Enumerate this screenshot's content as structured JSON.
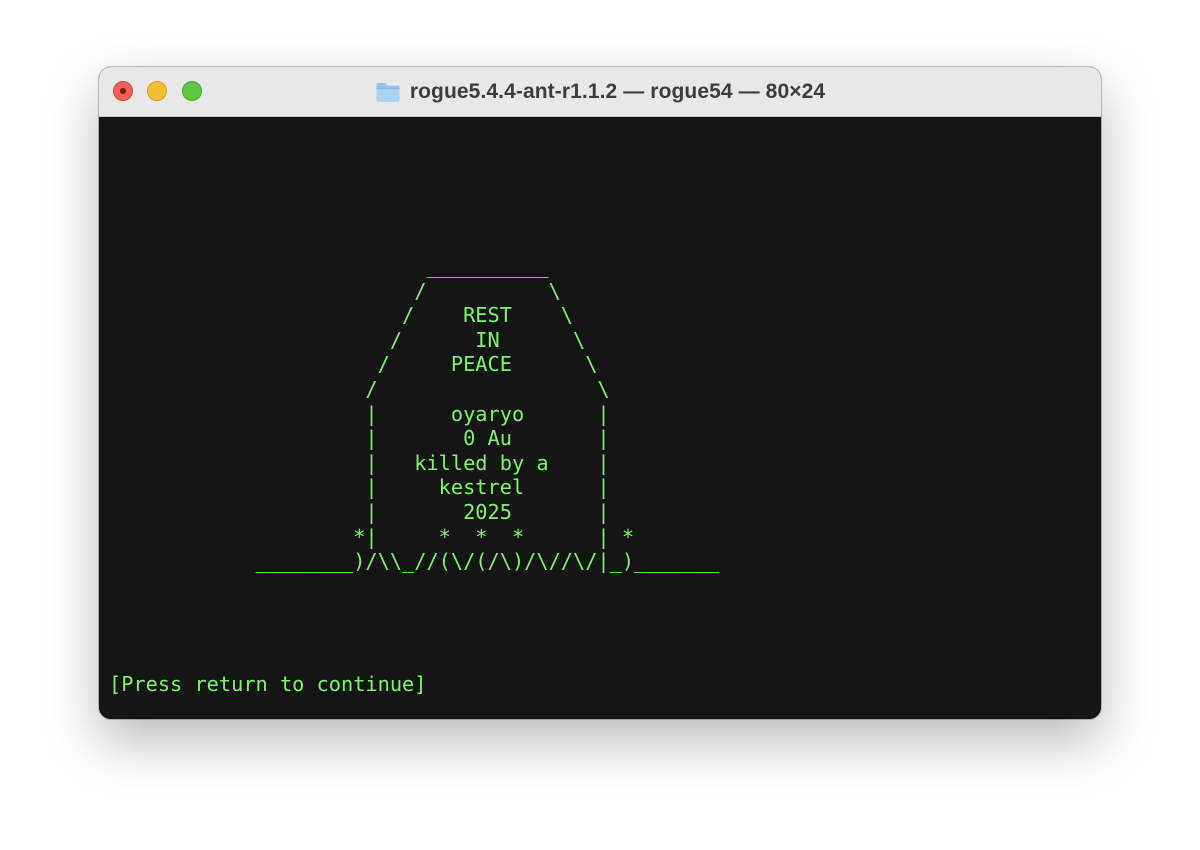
{
  "window": {
    "title": "rogue5.4.4-ant-r1.1.2 — rogue54 — 80×24",
    "title_icon": "folder-icon",
    "traffic_lights": {
      "close": "#ee5f57",
      "minimize": "#f5bd30",
      "zoom": "#5ec441"
    }
  },
  "terminal": {
    "background": "#151515",
    "foreground": "#7cf56b",
    "lines": [
      "",
      "",
      "",
      "",
      "",
      "                          __________",
      "                         /          \\",
      "                        /    REST    \\",
      "                       /      IN      \\",
      "                      /     PEACE      \\",
      "                     /                  \\",
      "                     |      oyaryo      |",
      "                     |       0 Au       |",
      "                     |   killed by a    |",
      "                     |     kestrel      |",
      "                     |       2025       |",
      "                    *|     *  *  *      | *",
      "            ________)/\\\\_//(\\/(/\\)/\\//\\/|_)_______",
      "",
      "",
      "",
      "",
      "[Press return to continue]",
      ""
    ]
  }
}
